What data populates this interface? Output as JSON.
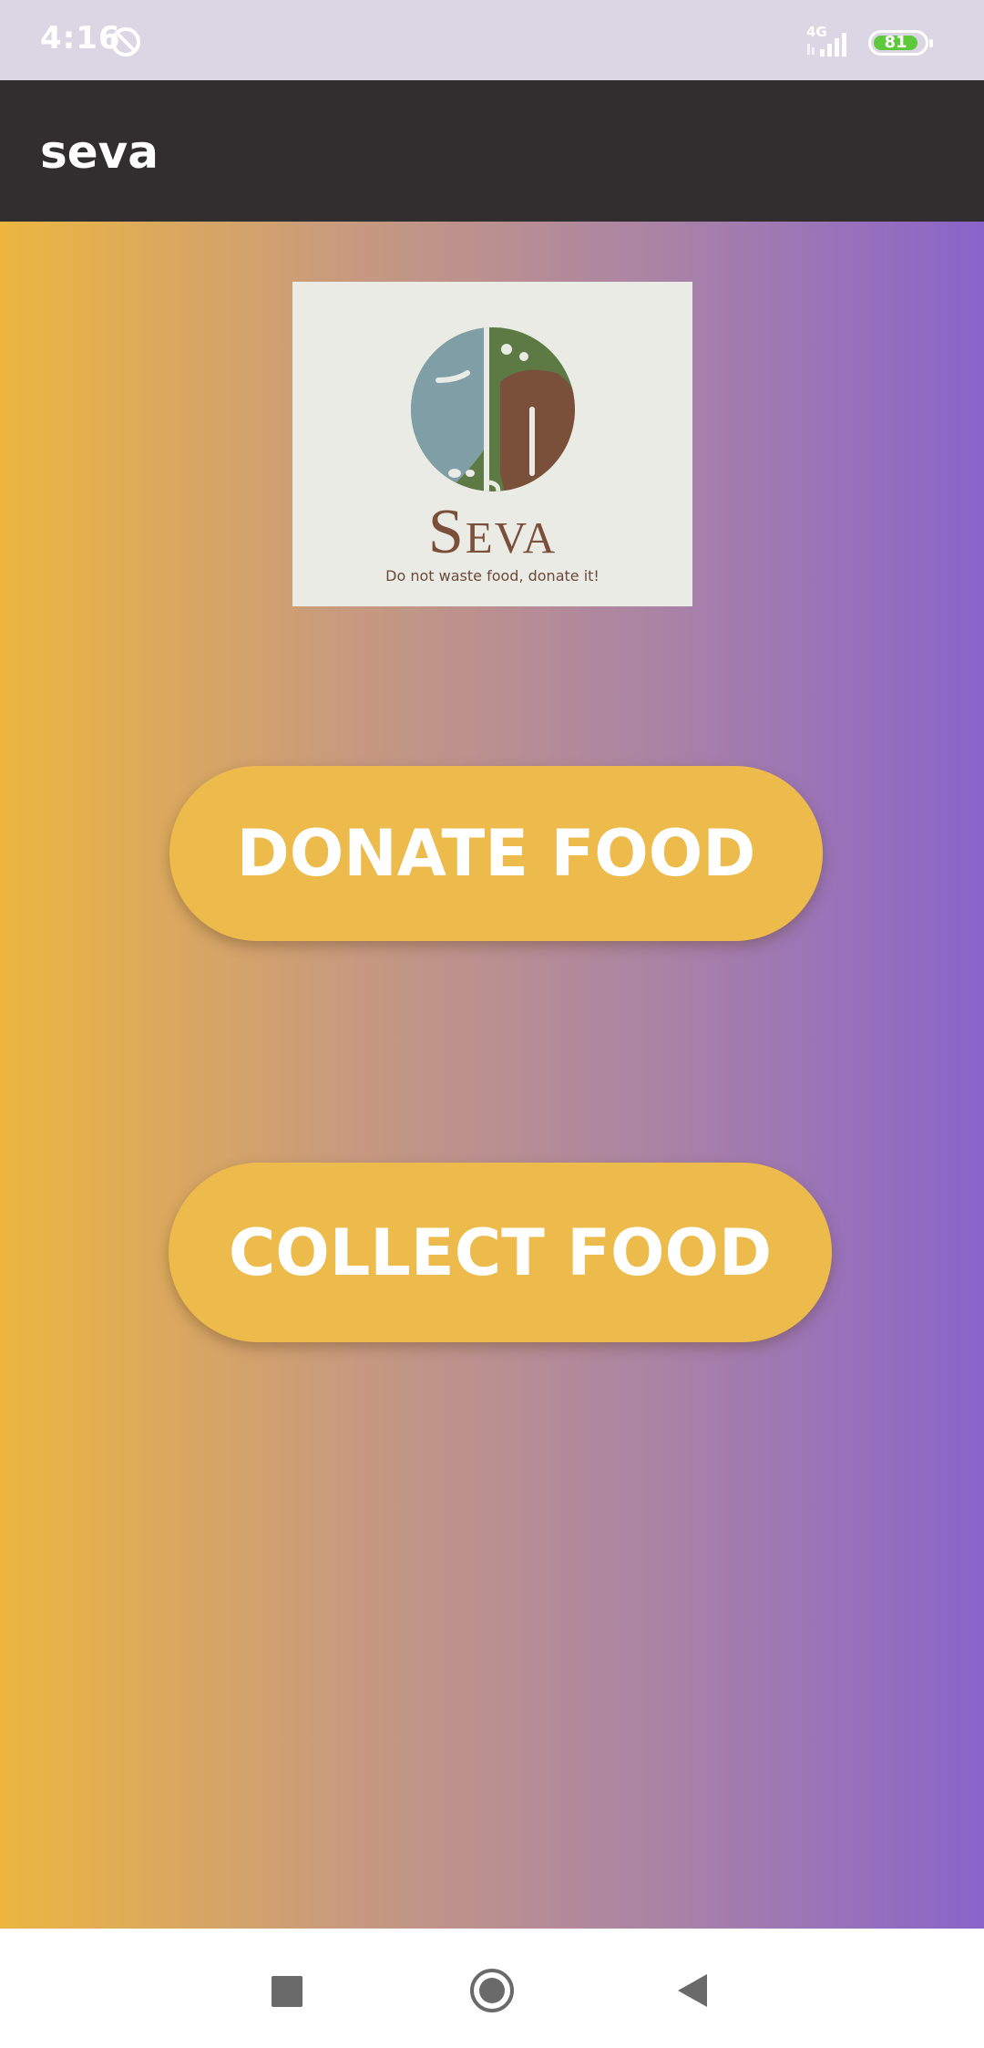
{
  "status_bar": {
    "time": "4:16",
    "network": "4G",
    "battery_level": "81",
    "icons": [
      "do-not-disturb-icon",
      "signal-icon",
      "battery-icon"
    ]
  },
  "app_bar": {
    "title": "seva"
  },
  "logo": {
    "wordmark": "Seva",
    "tagline": "Do not waste food, donate it!"
  },
  "actions": {
    "donate_label": "DONATE FOOD",
    "collect_label": "COLLECT FOOD"
  },
  "nav_bar": {
    "icons": [
      "recent-apps-icon",
      "home-icon",
      "back-icon"
    ]
  },
  "colors": {
    "app_bar": "#312e2f",
    "button": "#ecbb4c",
    "gradient_start": "#ecb640",
    "gradient_end": "#8a64ca",
    "logo_brown": "#7b503b",
    "logo_blue": "#7f9ea5",
    "logo_green": "#5e7a44"
  }
}
